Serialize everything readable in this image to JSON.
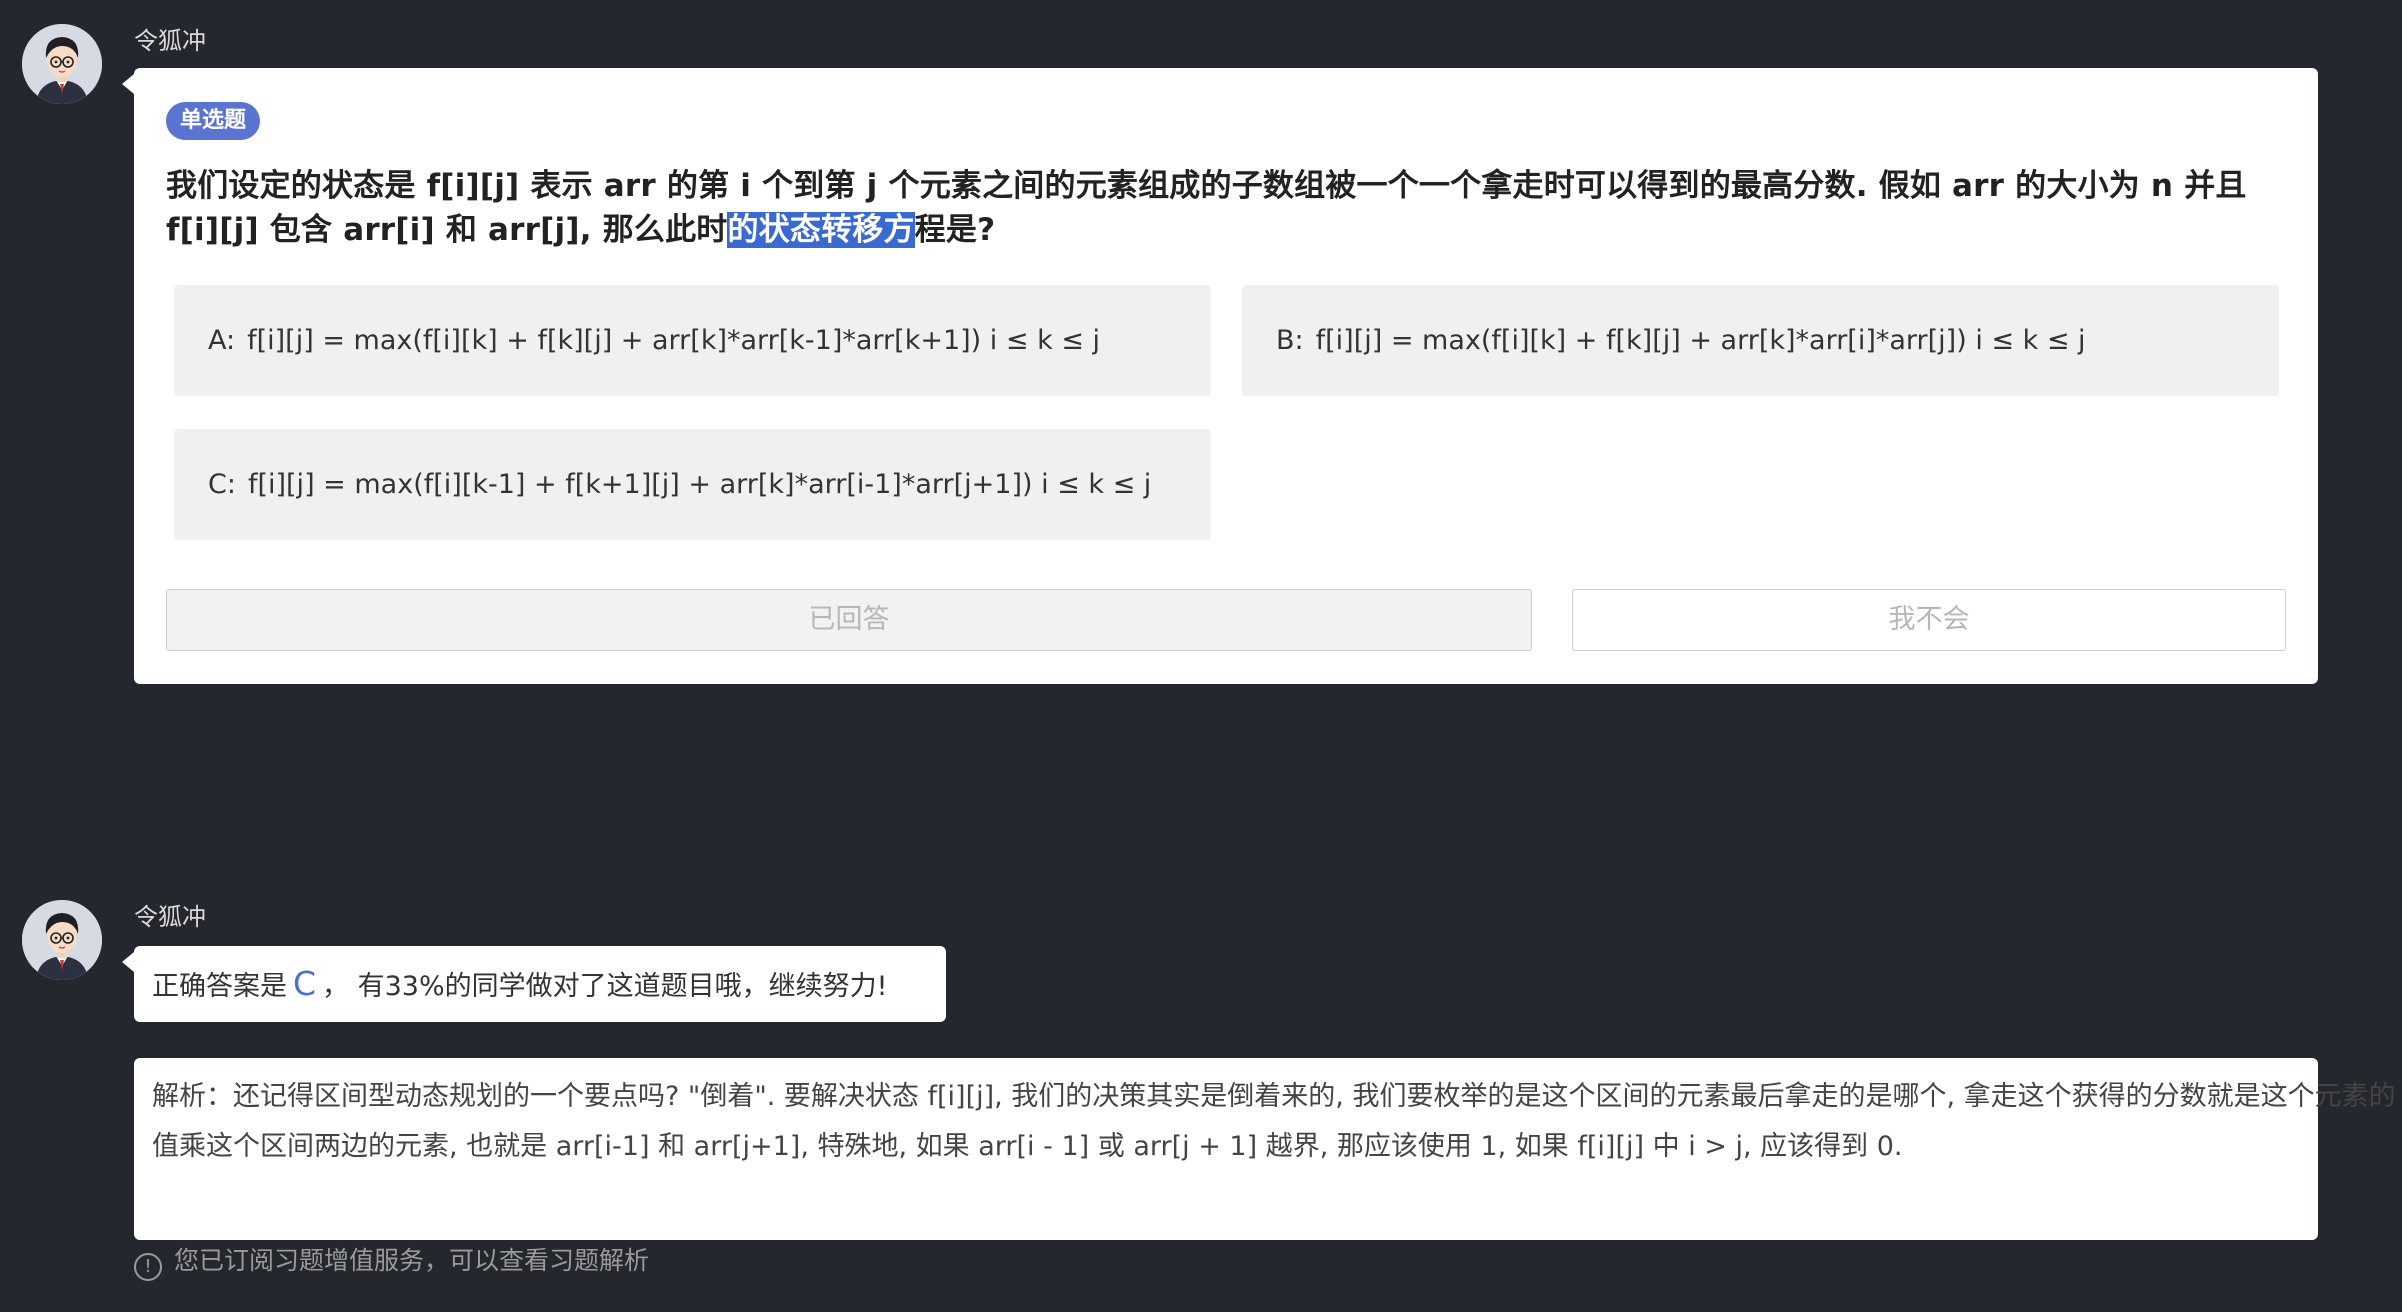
{
  "messages": [
    {
      "sender": "令狐冲",
      "question": {
        "badge": "单选题",
        "text_before": "我们设定的状态是 f[i][j] 表示 arr 的第 i 个到第 j 个元素之间的元素组成的子数组被一个一个拿走时可以得到的最高分数. 假如 arr 的大小为 n 并且 f[i][j] 包含 arr[i] 和 arr[j], 那么此时",
        "text_highlighted": "的状态转移方",
        "text_after": "程是?",
        "options": [
          {
            "key": "A:",
            "text": "f[i][j] = max(f[i][k] + f[k][j] + arr[k]*arr[k-1]*arr[k+1]) i ≤ k ≤ j"
          },
          {
            "key": "B:",
            "text": "f[i][j] = max(f[i][k] + f[k][j] + arr[k]*arr[i]*arr[j]) i ≤ k ≤ j"
          },
          {
            "key": "C:",
            "text": "f[i][j] = max(f[i][k-1] + f[k+1][j] + arr[k]*arr[i-1]*arr[j+1]) i ≤ k ≤ j"
          }
        ],
        "answered_label": "已回答",
        "dont_know_label": "我不会"
      }
    },
    {
      "sender": "令狐冲",
      "answer": {
        "prefix": "正确答案是",
        "letter": "C",
        "suffix": "， 有33%的同学做对了这道题目哦，继续努力!"
      },
      "analysis": "解析：还记得区间型动态规划的一个要点吗? \"倒着\". 要解决状态 f[i][j], 我们的决策其实是倒着来的, 我们要枚举的是这个区间的元素最后拿走的是哪个, 拿走这个获得的分数就是这个元素的值乘这个区间两边的元素, 也就是 arr[i-1] 和 arr[j+1], 特殊地, 如果 arr[i - 1] 或 arr[j + 1] 越界, 那应该使用 1, 如果 f[i][j] 中 i > j, 应该得到 0."
    }
  ],
  "footer_note": {
    "icon": "info-icon",
    "text": "您已订阅习题增值服务，可以查看习题解析"
  },
  "colors": {
    "background": "#25272e",
    "accent": "#5b74d2",
    "highlight": "#3a69d1"
  }
}
